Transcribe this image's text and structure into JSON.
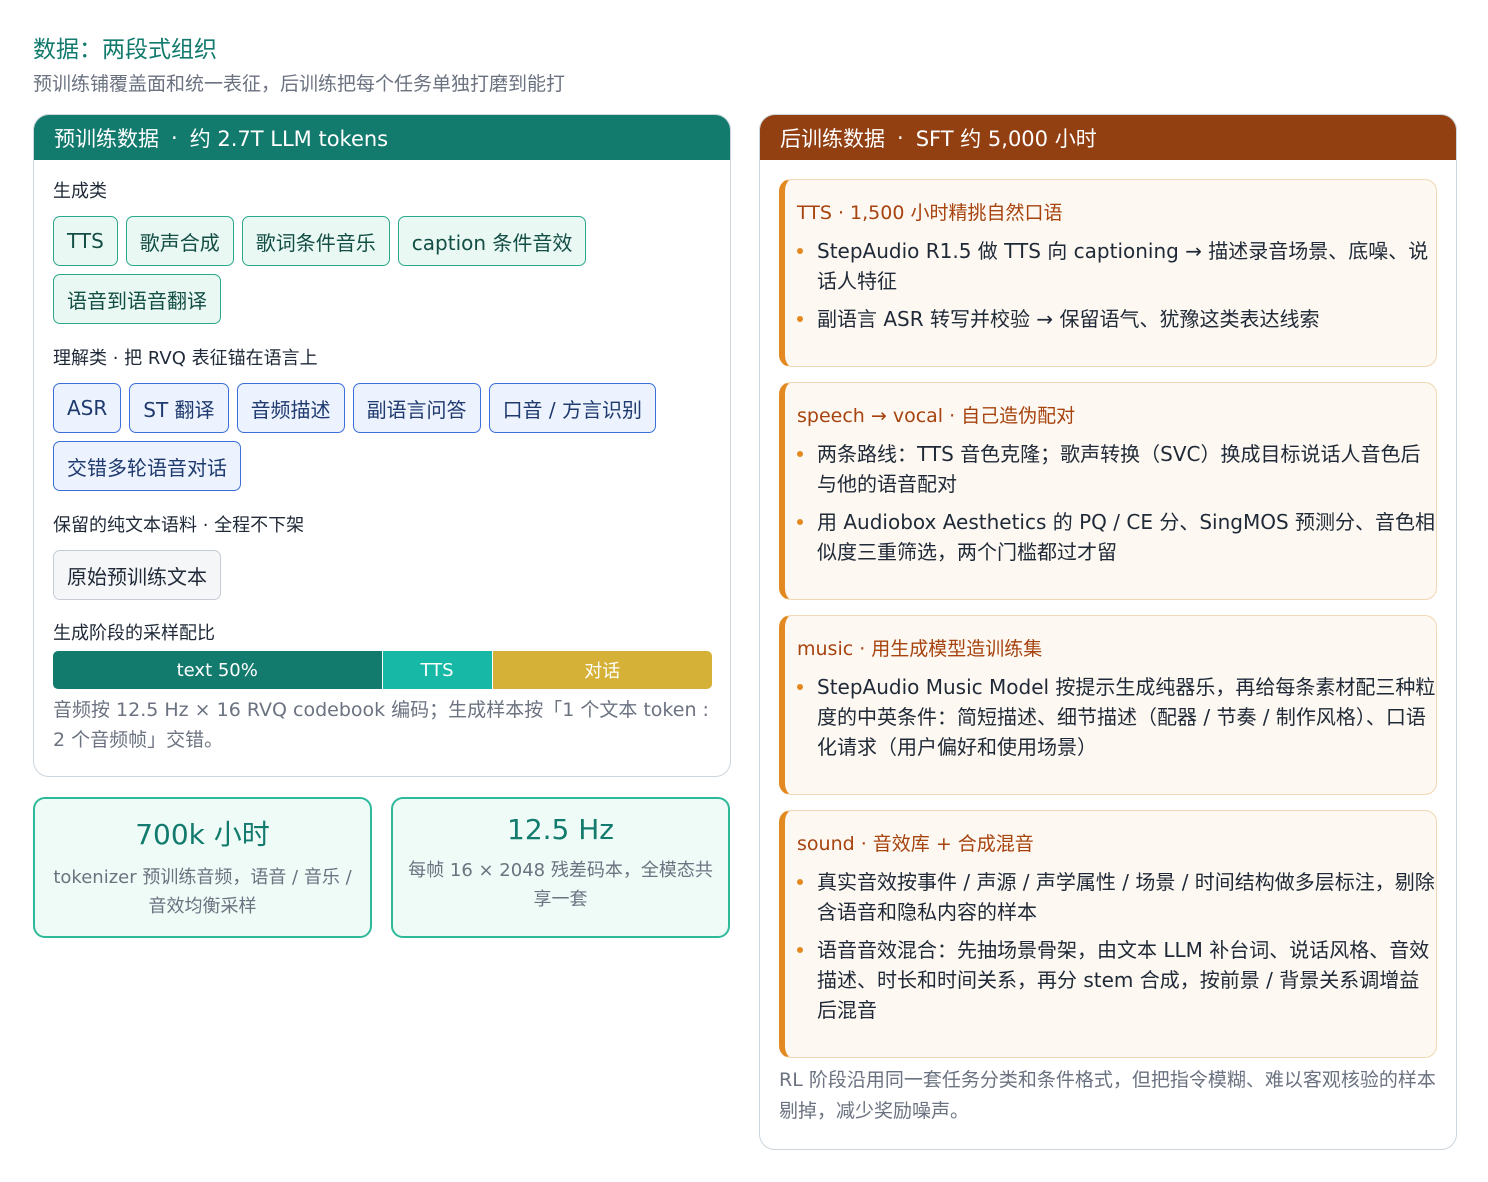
{
  "page": {
    "title": "数据：两段式组织",
    "subtitle": "预训练铺覆盖面和统一表征，后训练把每个任务单独打磨到能打"
  },
  "pretrain": {
    "header_name": "预训练数据",
    "header_sep": "·",
    "header_scale": "约 2.7T LLM tokens",
    "gen_group": {
      "title": "生成类",
      "chips": [
        "TTS",
        "歌声合成",
        "歌词条件音乐",
        "caption 条件音效",
        "语音到语音翻译"
      ]
    },
    "und_group": {
      "title": "理解类 · 把 RVQ 表征锚在语言上",
      "chips": [
        "ASR",
        "ST 翻译",
        "音频描述",
        "副语言问答",
        "口音 / 方言识别",
        "交错多轮语音对话"
      ]
    },
    "text_group": {
      "title": "保留的纯文本语料 · 全程不下架",
      "chips": [
        "原始预训练文本"
      ]
    },
    "ratio": {
      "title": "生成阶段的采样配比",
      "segments": [
        {
          "label": "text 50%",
          "fraction": 0.5,
          "color": "#137a6e"
        },
        {
          "label": "TTS",
          "fraction": 0.167,
          "color": "#17b8a6"
        },
        {
          "label": "对话",
          "fraction": 0.333,
          "color": "#d6b137"
        }
      ],
      "note": "音频按 12.5 Hz × 16 RVQ codebook 编码；生成样本按「1 个文本 token : 2 个音频帧」交错。"
    }
  },
  "stats": [
    {
      "value": "700k 小时",
      "label": "tokenizer 预训练音频，语音 / 音乐 / 音效均衡采样"
    },
    {
      "value": "12.5 Hz",
      "label": "每帧 16 × 2048 残差码本，全模态共享一套"
    }
  ],
  "posttrain": {
    "header_name": "后训练数据",
    "header_sep": "·",
    "header_scale": "SFT 约 5,000 小时",
    "cards": [
      {
        "title": "TTS · 1,500 小时精挑自然口语",
        "items": [
          "StepAudio R1.5 做 TTS 向 captioning → 描述录音场景、底噪、说话人特征",
          "副语言 ASR 转写并校验 → 保留语气、犹豫这类表达线索"
        ]
      },
      {
        "title": "speech → vocal · 自己造伪配对",
        "items": [
          "两条路线：TTS 音色克隆；歌声转换（SVC）换成目标说话人音色后与他的语音配对",
          "用 Audiobox Aesthetics 的 PQ / CE 分、SingMOS 预测分、音色相似度三重筛选，两个门槛都过才留"
        ]
      },
      {
        "title": "music · 用生成模型造训练集",
        "items": [
          "StepAudio Music Model 按提示生成纯器乐，再给每条素材配三种粒度的中英条件：简短描述、细节描述（配器 / 节奏 / 制作风格）、口语化请求（用户偏好和使用场景）"
        ]
      },
      {
        "title": "sound · 音效库 + 合成混音",
        "items": [
          "真实音效按事件 / 声源 / 声学属性 / 场景 / 时间结构做多层标注，剔除含语音和隐私内容的样本",
          "语音音效混合：先抽场景骨架，由文本 LLM 补台词、说话风格、音效描述、时长和时间关系，再分 stem 合成，按前景 / 背景关系调增益后混音"
        ]
      }
    ],
    "footnote": "RL 阶段沿用同一套任务分类和条件格式，但把指令模糊、难以客观核验的样本剔掉，减少奖励噪声。"
  }
}
